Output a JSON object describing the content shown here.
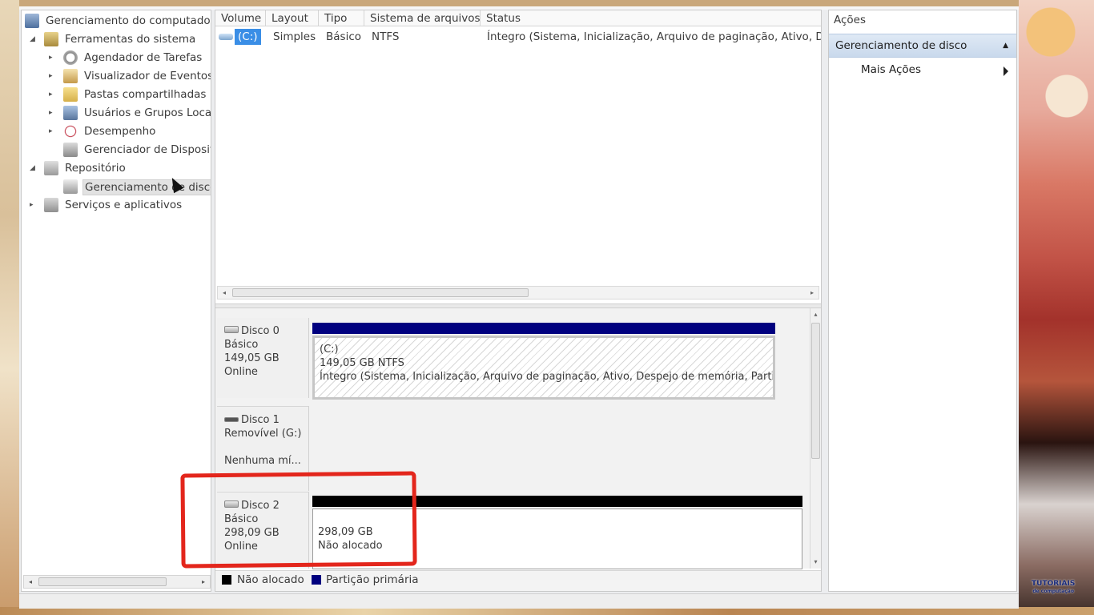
{
  "tree": {
    "root": "Gerenciamento do computador",
    "items": [
      {
        "label": "Ferramentas do sistema",
        "expanded": true
      },
      {
        "label": "Agendador de Tarefas",
        "expanded": false
      },
      {
        "label": "Visualizador de Eventos",
        "expanded": false
      },
      {
        "label": "Pastas compartilhadas",
        "expanded": false
      },
      {
        "label": "Usuários e Grupos Locais",
        "expanded": false
      },
      {
        "label": "Desempenho",
        "expanded": false
      },
      {
        "label": "Gerenciador de Dispositivos"
      },
      {
        "label": "Repositório",
        "expanded": true
      },
      {
        "label": "Gerenciamento de disco",
        "selected": true
      },
      {
        "label": "Serviços e aplicativos",
        "expanded": false
      }
    ]
  },
  "table": {
    "headers": [
      "Volume",
      "Layout",
      "Tipo",
      "Sistema de arquivos",
      "Status"
    ],
    "rows": [
      {
        "volume": "(C:)",
        "layout": "Simples",
        "tipo": "Básico",
        "fs": "NTFS",
        "status": "Íntegro (Sistema, Inicialização, Arquivo de paginação, Ativo, Despejo de memória, Partição Primária)"
      }
    ]
  },
  "disks": [
    {
      "name": "Disco 0",
      "type": "Básico",
      "size": "149,05 GB",
      "state": "Online",
      "partition": {
        "title": "(C:)",
        "size": "149,05 GB NTFS",
        "status": "Íntegro (Sistema, Inicialização, Arquivo de paginação, Ativo, Despejo de memória, Partição Primária)",
        "bar_color": "#00007f"
      }
    },
    {
      "name": "Disco 1",
      "type": "Removível (G:)",
      "size": "",
      "state": "Nenhuma mí..."
    },
    {
      "name": "Disco 2",
      "type": "Básico",
      "size": "298,09 GB",
      "state": "Online",
      "partition": {
        "size": "298,09 GB",
        "status": "Não alocado",
        "bar_color": "#000000"
      }
    }
  ],
  "legend": [
    {
      "label": "Não alocado",
      "color": "#000000"
    },
    {
      "label": "Partição primária",
      "color": "#00007f"
    }
  ],
  "actions": {
    "title": "Ações",
    "section": "Gerenciamento de disco",
    "more": "Mais Ações"
  },
  "watermark": {
    "line1": "TUTORIAIS",
    "line2": "de computação"
  }
}
